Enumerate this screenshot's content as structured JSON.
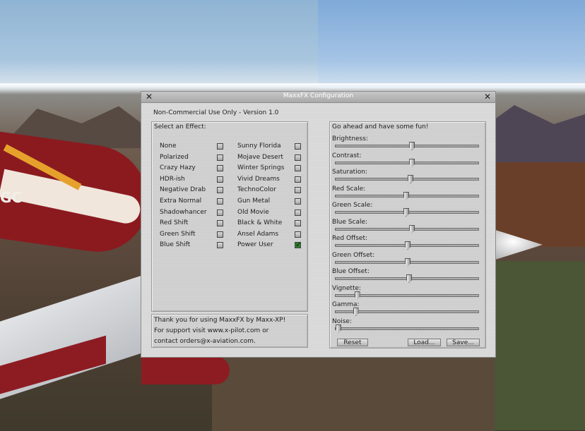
{
  "window": {
    "title": "MaxxFX Configuration",
    "version_note": "Non-Commercial Use Only - Version 1.0"
  },
  "effects": {
    "heading": "Select an Effect:",
    "column1": [
      {
        "label": "None",
        "checked": false
      },
      {
        "label": "Polarized",
        "checked": false
      },
      {
        "label": "Crazy Hazy",
        "checked": false
      },
      {
        "label": "HDR-ish",
        "checked": false
      },
      {
        "label": "Negative Drab",
        "checked": false
      },
      {
        "label": "Extra Normal",
        "checked": false
      },
      {
        "label": "Shadowhancer",
        "checked": false
      },
      {
        "label": "Red Shift",
        "checked": false
      },
      {
        "label": "Green Shift",
        "checked": false
      },
      {
        "label": "Blue Shift",
        "checked": false
      }
    ],
    "column2": [
      {
        "label": "Sunny Florida",
        "checked": false
      },
      {
        "label": "Mojave Desert",
        "checked": false
      },
      {
        "label": "Winter Springs",
        "checked": false
      },
      {
        "label": "Vivid Dreams",
        "checked": false
      },
      {
        "label": "TechnoColor",
        "checked": false
      },
      {
        "label": "Gun Metal",
        "checked": false
      },
      {
        "label": "Old Movie",
        "checked": false
      },
      {
        "label": "Black & White",
        "checked": false
      },
      {
        "label": "Ansel Adams",
        "checked": false
      },
      {
        "label": "Power User",
        "checked": true
      }
    ]
  },
  "thanks": {
    "line1": "Thank you for using MaxxFX by Maxx-XP!",
    "line2": "For support visit www.x-pilot.com or",
    "line3": "contact orders@x-aviation.com."
  },
  "adjust": {
    "heading": "Go ahead and have some fun!",
    "sliders": [
      {
        "label": "Brightness:",
        "value": 0.53
      },
      {
        "label": "Contrast:",
        "value": 0.53
      },
      {
        "label": "Saturation:",
        "value": 0.52
      },
      {
        "label": "Red Scale:",
        "value": 0.49
      },
      {
        "label": "Green Scale:",
        "value": 0.49
      },
      {
        "label": "Blue Scale:",
        "value": 0.53
      },
      {
        "label": "Red Offset:",
        "value": 0.5
      },
      {
        "label": "Green Offset:",
        "value": 0.5
      },
      {
        "label": "Blue Offset:",
        "value": 0.51
      },
      {
        "label": "Vignette:",
        "value": 0.15
      },
      {
        "label": "Gamma:",
        "value": 0.14
      },
      {
        "label": "Noise:",
        "value": 0.02
      }
    ],
    "buttons": {
      "reset": "Reset",
      "load": "Load...",
      "save": "Save..."
    }
  },
  "background": {
    "aircraft_registration": "GC"
  }
}
